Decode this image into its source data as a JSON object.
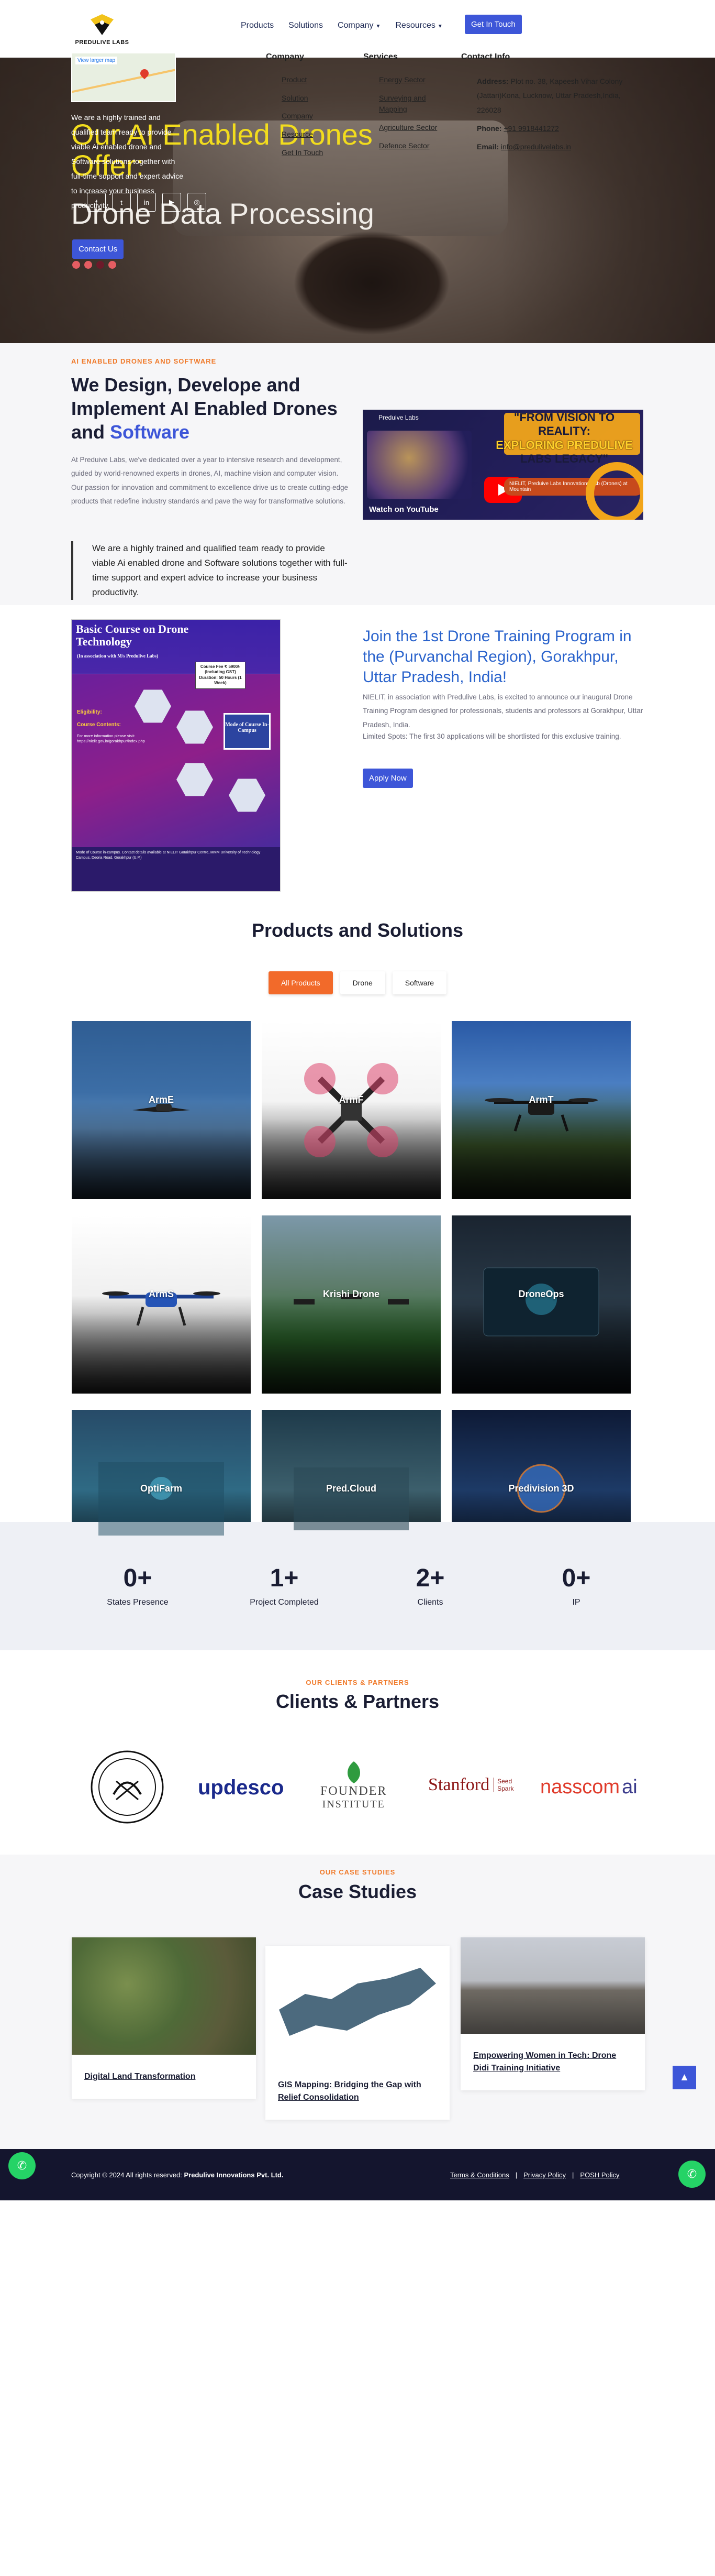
{
  "nav": {
    "logo_text": "PREDULIVE LABS",
    "links": [
      "Products",
      "Solutions",
      "Company",
      "Resources"
    ],
    "cta": "Get In Touch"
  },
  "hero": {
    "title_line1": "Our AI Enabled Drones",
    "title_line2": "Offer:",
    "subtitle": "Drone Data Processing",
    "cta": "Contact Us",
    "slides": 4,
    "active_slide": 2
  },
  "about": {
    "eyebrow": "AI ENABLED DRONES AND SOFTWARE",
    "title_main": "We Design, Develope and Implement AI Enabled Drones and ",
    "title_accent": "Software",
    "lead": "At Preduive Labs, we've dedicated over a year to intensive research and development, guided by world-renowned experts in drones, AI, machine vision and computer vision. Our passion for innovation and commitment to excellence drive us to create cutting-edge products that redefine industry standards and pave the way for transformative solutions.",
    "quote": "We are a highly trained and qualified team ready to provide viable Ai enabled drone and Software solutions together with full-time support and expert advice to increase your business productivity.",
    "video": {
      "channel": "Preduive Labs",
      "title_line1": "\"FROM VISION TO REALITY:",
      "title_line2": "EXPLORING PREDULIVE",
      "title_line3": "LABS LEGACY\"",
      "pill": "NIELIT, Preduive Labs Innovations Lab (Drones) at Mountain",
      "watch_on": "Watch on  YouTube"
    }
  },
  "course": {
    "poster": {
      "title": "Basic Course on Drone Technology",
      "subtitle": "(In association with M/s Predulive Labs)",
      "fee": "Course Fee ₹ 5900/- (Including GST) Duration: 50 Hours (1 Week)",
      "mode": "Mode of Course In-Campus",
      "eligibility": "Eligibility:",
      "contents": "Course Contents:",
      "more_info": "For more information please visit: https://nielit.gov.in/gorakhpur/index.php",
      "footer": "Mode of Course in-campus. Contact details available at NIELIT Gorakhpur Centre, MMM University of Technology Campus, Deoria Road, Gorakhpur (U.P.)"
    },
    "title": "Join the 1st Drone Training Program in the (Purvanchal Region), Gorakhpur, Uttar Pradesh, India!",
    "p1": "NIELIT, in association with Predulive Labs, is excited to announce our inaugural Drone Training Program designed for professionals, students and professors at Gorakhpur, Uttar Pradesh, India.",
    "p2": "Limited Spots: The first 30 applications will be shortlisted for this exclusive training.",
    "cta": "Apply Now"
  },
  "products": {
    "title": "Products and Solutions",
    "filters": [
      "All Products",
      "Drone",
      "Software"
    ],
    "active_filter": "All Products",
    "items": [
      "ArmE",
      "ArmF",
      "ArmT",
      "ArmS",
      "Krishi Drone",
      "DroneOps",
      "OptiFarm",
      "Pred.Cloud",
      "Predivision 3D"
    ]
  },
  "stats": [
    {
      "value": "0+",
      "label": "States Presence"
    },
    {
      "value": "1+",
      "label": "Project Completed"
    },
    {
      "value": "2+",
      "label": "Clients"
    },
    {
      "value": "0+",
      "label": "IP"
    }
  ],
  "clients": {
    "eyebrow": "OUR CLIENTS & PARTNERS",
    "title": "Clients & Partners",
    "logos": [
      "updesco",
      "FOUNDER",
      "INSTITUTE",
      "Stanford",
      "Seed",
      "Spark",
      "nasscom",
      "ai"
    ]
  },
  "cases": {
    "eyebrow": "OUR CASE STUDIES",
    "title": "Case Studies",
    "items": [
      "Digital Land Transformation",
      "GIS Mapping: Bridging the Gap with Relief Consolidation",
      "Empowering Women in Tech: Drone Didi Training Initiative"
    ]
  },
  "footer": {
    "map_label": "View larger map",
    "about": "We are a highly trained and qualified team ready to provide viable Ai enabled drone and Software solutions together with full-time support and expert advice to increase your business productivity.",
    "company_title": "Company",
    "company_links": [
      "Product",
      "Solution",
      "Company",
      "Resource",
      "Get In Touch"
    ],
    "services_title": "Services",
    "services_links": [
      "Energy Sector",
      "Surveying and Mapping",
      "Agriculture Sector",
      "Defence Sector"
    ],
    "contact_title": "Contact Info",
    "address_label": "Address:",
    "address": "Plot no. 38, Kapeesh Vihar Colony (Jattari)Kona, Lucknow, Uttar Pradesh,India, 226028",
    "phone_label": "Phone:",
    "phone": "+91 9918441272",
    "email_label": "Email:",
    "email": "info@predulivelabs.in",
    "copyright": "Copyright © 2024 All rights reserved: ",
    "company_name": "Predulive Innovations Pvt. Ltd.",
    "bottom_links": [
      "Terms & Conditions",
      "Privacy Policy",
      "POSH Policy"
    ]
  },
  "colors": {
    "primary": "#3d56d8",
    "accent_orange": "#f26a2a",
    "hero_yellow": "#f2dc1d",
    "footer_bg": "#1a1b3a"
  }
}
